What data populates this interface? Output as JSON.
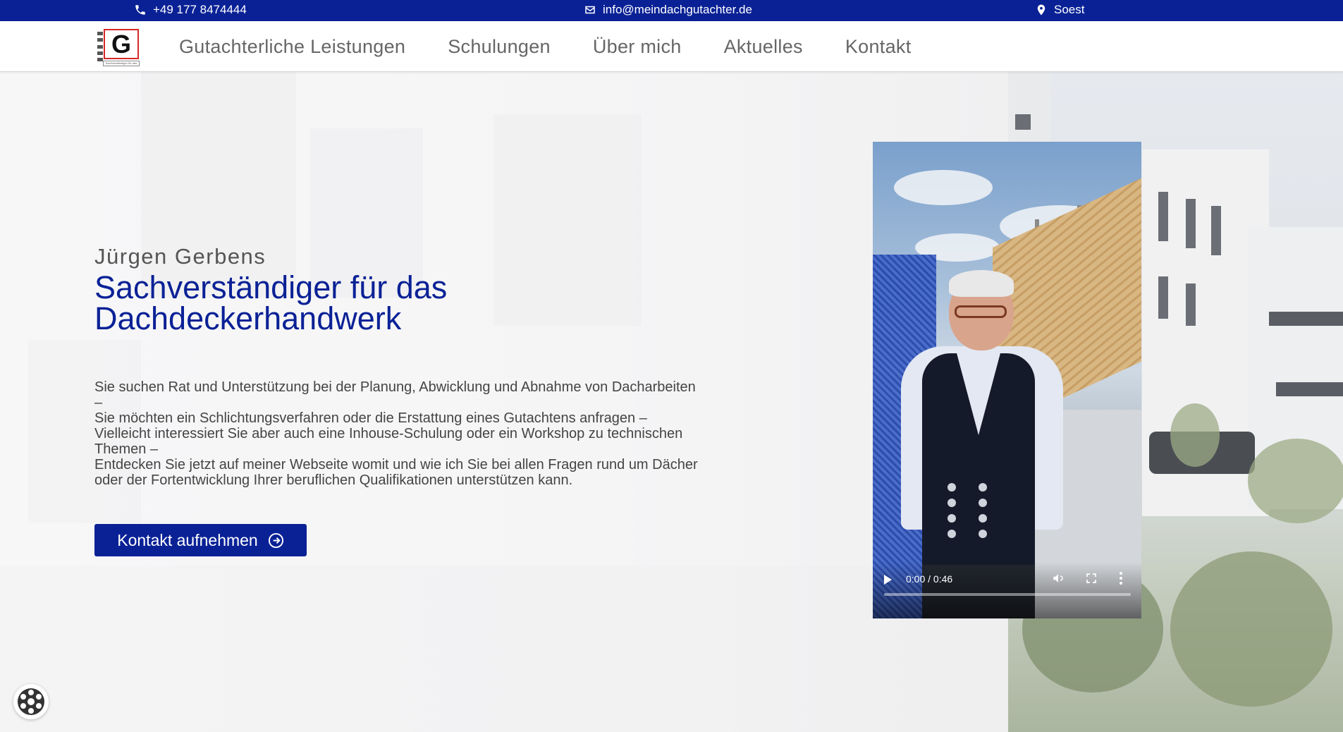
{
  "topbar": {
    "phone": "+49 177 8474444",
    "email": "info@meindachgutachter.de",
    "location": "Soest",
    "background": "#0a2196"
  },
  "logo": {
    "letter": "G",
    "tagline": "Sachverständiger für das Dachdeckerhandwerk"
  },
  "nav": {
    "items": [
      {
        "label": "Gutachterliche Leistungen"
      },
      {
        "label": "Schulungen"
      },
      {
        "label": "Über mich"
      },
      {
        "label": "Aktuelles"
      },
      {
        "label": "Kontakt"
      }
    ]
  },
  "hero": {
    "subtitle": "Jürgen Gerbens",
    "title": "Sachverständiger für das Dachdeckerhandwerk",
    "description": "Sie suchen Rat und Unterstützung bei der Planung, Abwicklung und Abnahme von Dacharbeiten\n–\nSie möchten ein Schlichtungsverfahren oder die Erstattung eines Gutachtens anfragen –\nVielleicht interessiert Sie aber auch eine Inhouse-Schulung oder ein Workshop zu technischen\nThemen –\nEntdecken Sie jetzt auf meiner Webseite womit und wie ich Sie bei allen Fragen rund um Dächer\noder der Fortentwicklung Ihrer beruflichen Qualifikationen unterstützen kann.",
    "cta_label": "Kontakt aufnehmen",
    "accent": "#0a2196"
  },
  "video": {
    "time": "0:00 / 0:46",
    "progress": 0
  },
  "icons": {
    "phone": "phone-icon",
    "mail": "envelope-icon",
    "location": "map-pin-icon",
    "cta": "arrow-circle-right-icon",
    "widget": "cookie-settings-icon"
  }
}
